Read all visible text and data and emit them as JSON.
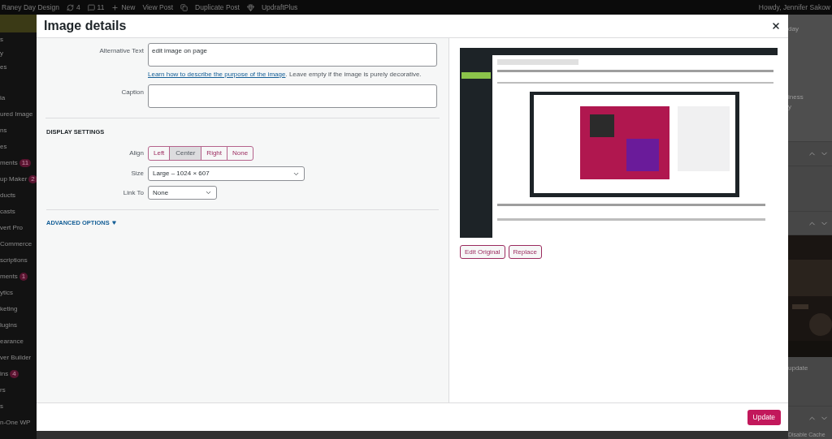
{
  "admin_bar": {
    "site": "Raney Day Design",
    "updates": "4",
    "comments": "11",
    "new": "New",
    "view": "View Post",
    "duplicate": "Duplicate Post",
    "updraft": "UpdraftPlus",
    "howdy": "Howdy, Jennifer Sakow"
  },
  "sidebar": {
    "items": [
      {
        "selected": true
      },
      {
        "label": "s",
        "selected": false
      },
      {
        "label": "y",
        "selected": false
      },
      {
        "label": "es",
        "selected": false
      },
      {
        "selected": false
      },
      {
        "label": "ia",
        "selected": false
      },
      {
        "label": "ured Image",
        "selected": false
      },
      {
        "label": "ns",
        "selected": false
      },
      {
        "label": "es",
        "selected": false
      },
      {
        "label": "ments",
        "badge": "11",
        "selected": false
      },
      {
        "label": "up Maker",
        "badge": "2",
        "selected": false
      },
      {
        "label": "ducts",
        "selected": false
      },
      {
        "label": "casts",
        "selected": false
      },
      {
        "label": "vert Pro",
        "selected": false
      },
      {
        "label": "Commerce",
        "selected": false
      },
      {
        "label": "scriptions",
        "selected": false
      },
      {
        "label": "ments",
        "badge": "1",
        "selected": false
      },
      {
        "label": "ytics",
        "selected": false
      },
      {
        "label": "keting",
        "selected": false
      },
      {
        "label": "lugins",
        "selected": false
      },
      {
        "label": "earance",
        "selected": false
      },
      {
        "label": "ver Builder",
        "selected": false
      },
      {
        "label": "ins",
        "badge": "4",
        "selected": false
      },
      {
        "label": "rs",
        "selected": false
      },
      {
        "label": "s",
        "selected": false
      },
      {
        "label": "n-One WP",
        "selected": false
      }
    ]
  },
  "right_panel": {
    "texts": [
      "day",
      "iness",
      "y"
    ],
    "update_text": "update",
    "cache": "Disable Cache"
  },
  "modal": {
    "title": "Image details",
    "alt_text": {
      "label": "Alternative Text",
      "value": "edit image on page"
    },
    "help": {
      "link": "Learn how to describe the purpose of the image",
      "rest": ". Leave empty if the image is purely decorative."
    },
    "caption": {
      "label": "Caption"
    },
    "display_settings": "DISPLAY SETTINGS",
    "align": {
      "label": "Align",
      "options": [
        {
          "label": "Left",
          "selected": false
        },
        {
          "label": "Center",
          "selected": true
        },
        {
          "label": "Right",
          "selected": false
        },
        {
          "label": "None",
          "selected": false
        }
      ]
    },
    "size": {
      "label": "Size",
      "value": "Large – 1024 × 607"
    },
    "link_to": {
      "label": "Link To",
      "value": "None"
    },
    "advanced": {
      "label": "ADVANCED OPTIONS",
      "expanded": false
    },
    "image_buttons": [
      "Edit Original",
      "Replace"
    ],
    "update": "Update"
  }
}
